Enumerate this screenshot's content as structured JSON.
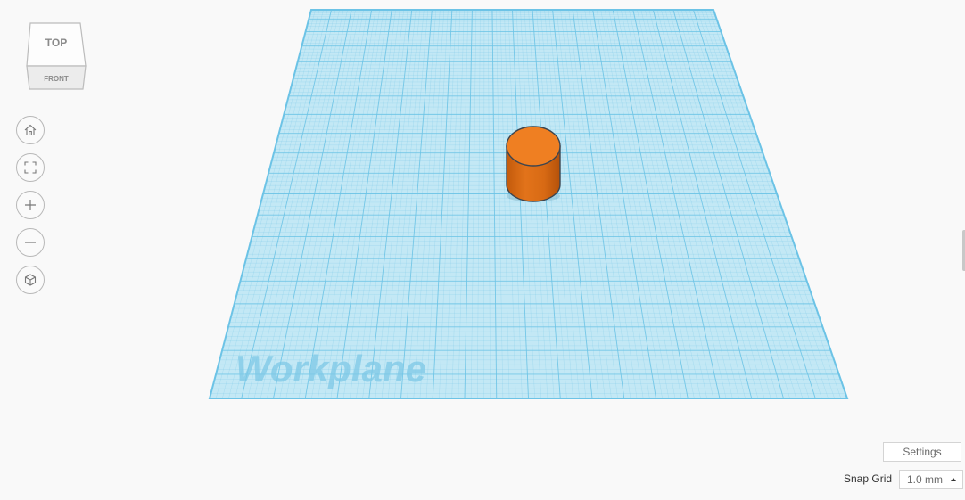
{
  "viewcube": {
    "top_label": "TOP",
    "front_label": "FRONT"
  },
  "nav": {
    "icons": [
      "home-icon",
      "fit-view-icon",
      "zoom-in-icon",
      "zoom-out-icon",
      "ortho-cube-icon"
    ]
  },
  "workplane": {
    "label": "Workplane",
    "grid_color": "#6cc3e6",
    "fill_color": "#c3e8f5"
  },
  "shape": {
    "type": "cylinder",
    "color": "#ef7f22"
  },
  "footer": {
    "settings_label": "Settings",
    "snap_grid_label": "Snap Grid",
    "snap_grid_value": "1.0 mm"
  }
}
